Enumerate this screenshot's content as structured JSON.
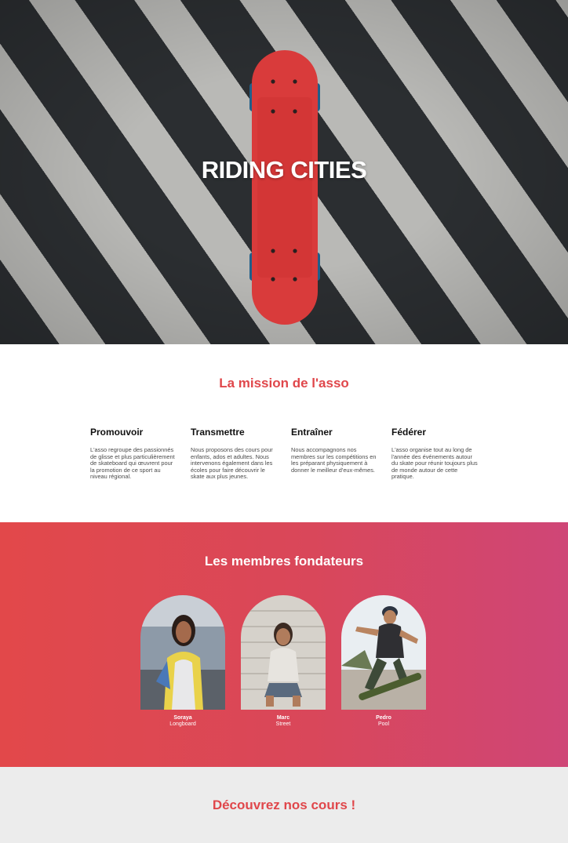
{
  "hero": {
    "title": "RIDING CITIES"
  },
  "mission": {
    "title": "La mission de l'asso",
    "items": [
      {
        "title": "Promouvoir",
        "text": "L'asso regroupe des passionnés de glisse et plus particulièrement de skateboard qui œuvrent pour la promotion de ce sport au niveau régional."
      },
      {
        "title": "Transmettre",
        "text": "Nous proposons des cours pour enfants, ados et adultes. Nous intervenons également dans les écoles pour faire découvrir le skate aux plus jeunes."
      },
      {
        "title": "Entraîner",
        "text": "Nous accompagnons nos membres sur les compétitions en les préparant physiquement à donner le meilleur d'eux-mêmes."
      },
      {
        "title": "Fédérer",
        "text": "L'asso organise tout au long de l'année des événements autour du skate pour réunir toujours plus de monde autour de cette pratique."
      }
    ]
  },
  "founders": {
    "title": "Les membres fondateurs",
    "members": [
      {
        "name": "Soraya",
        "style": "Longboard"
      },
      {
        "name": "Marc",
        "style": "Street"
      },
      {
        "name": "Pedro",
        "style": "Pool"
      }
    ]
  },
  "courses": {
    "title": "Découvrez nos cours !"
  },
  "colors": {
    "accent": "#e0474b",
    "gradient_start": "#e2484a",
    "gradient_end": "#cf4677",
    "courses_bg": "#ececec"
  }
}
